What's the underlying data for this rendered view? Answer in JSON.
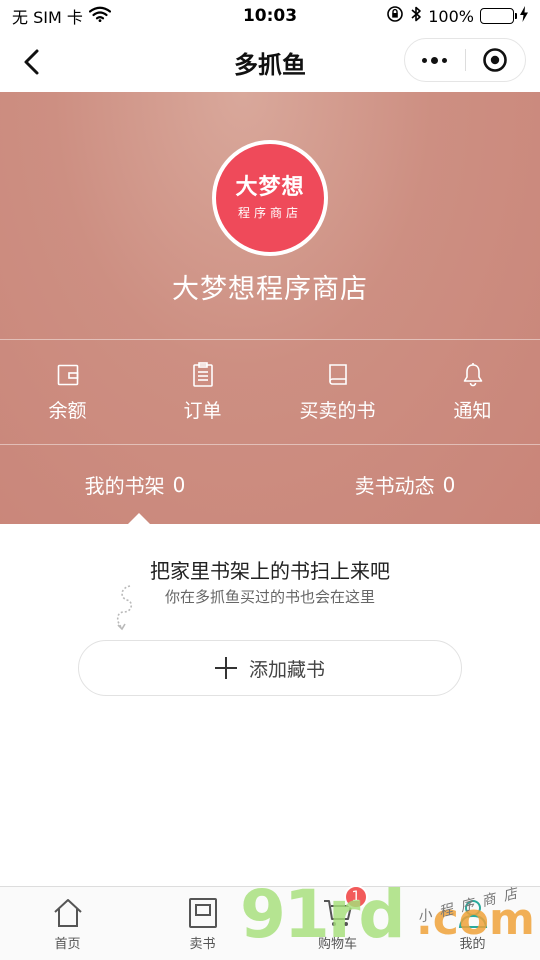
{
  "status_bar": {
    "carrier": "无 SIM 卡",
    "time": "10:03",
    "battery_percent": "100%",
    "battery_color": "#2fc24a"
  },
  "nav": {
    "title": "多抓鱼",
    "back_icon": "chevron-left-icon",
    "more_icon": "more-dots-icon",
    "close_icon": "target-circle-icon"
  },
  "store": {
    "logo_main": "大梦想",
    "logo_sub": "程序商店",
    "name": "大梦想程序商店",
    "logo_color": "#ef4a5a"
  },
  "theme": {
    "header_color": "#cd8f82",
    "badge_color": "#f25b5b"
  },
  "quick_menu": [
    {
      "label": "余额",
      "icon": "wallet-icon"
    },
    {
      "label": "订单",
      "icon": "clipboard-icon"
    },
    {
      "label": "买卖的书",
      "icon": "book-icon"
    },
    {
      "label": "通知",
      "icon": "bell-icon"
    }
  ],
  "shelf_tabs": [
    {
      "label": "我的书架",
      "count": "0",
      "active": true
    },
    {
      "label": "卖书动态",
      "count": "0",
      "active": false
    }
  ],
  "empty_state": {
    "title": "把家里书架上的书扫上来吧",
    "subtitle": "你在多抓鱼买过的书也会在这里",
    "add_button_label": "添加藏书"
  },
  "tab_bar": [
    {
      "label": "首页",
      "icon": "home-icon"
    },
    {
      "label": "卖书",
      "icon": "sell-book-icon"
    },
    {
      "label": "购物车",
      "icon": "cart-icon",
      "badge": "1"
    },
    {
      "label": "我的",
      "icon": "user-icon"
    }
  ],
  "watermark": {
    "big": "91rd",
    "small": ".com",
    "hand": "小程序商店"
  }
}
